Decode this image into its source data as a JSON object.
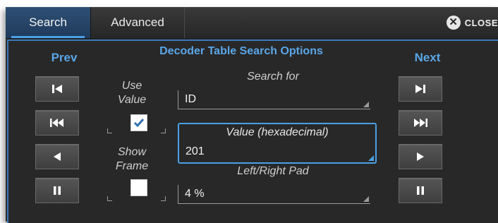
{
  "tabs": [
    {
      "label": "Search",
      "active": true
    },
    {
      "label": "Advanced",
      "active": false
    }
  ],
  "close": {
    "label": "CLOSE",
    "icon": "close-circle-icon"
  },
  "panel": {
    "title": "Decoder Table Search Options",
    "prev_label": "Prev",
    "next_label": "Next",
    "use_value_label": "Use Value",
    "use_value_checked": true,
    "show_frame_label": "Show Frame",
    "show_frame_checked": false,
    "search_for": {
      "caption": "Search for",
      "value": "ID"
    },
    "value_hex": {
      "caption": "Value (hexadecimal)",
      "value": "201"
    },
    "pad": {
      "caption": "Left/Right Pad",
      "value": "4 %"
    }
  },
  "prev_buttons": [
    "skip-to-first-icon",
    "fast-rewind-icon",
    "step-back-icon",
    "pause-icon"
  ],
  "next_buttons": [
    "skip-to-last-icon",
    "fast-forward-icon",
    "step-forward-icon",
    "pause-icon"
  ],
  "colors": {
    "accent": "#4aa0e6",
    "title": "#5aa6e8",
    "background": "#2b2b2b",
    "active_tab": "#2e4f74"
  }
}
